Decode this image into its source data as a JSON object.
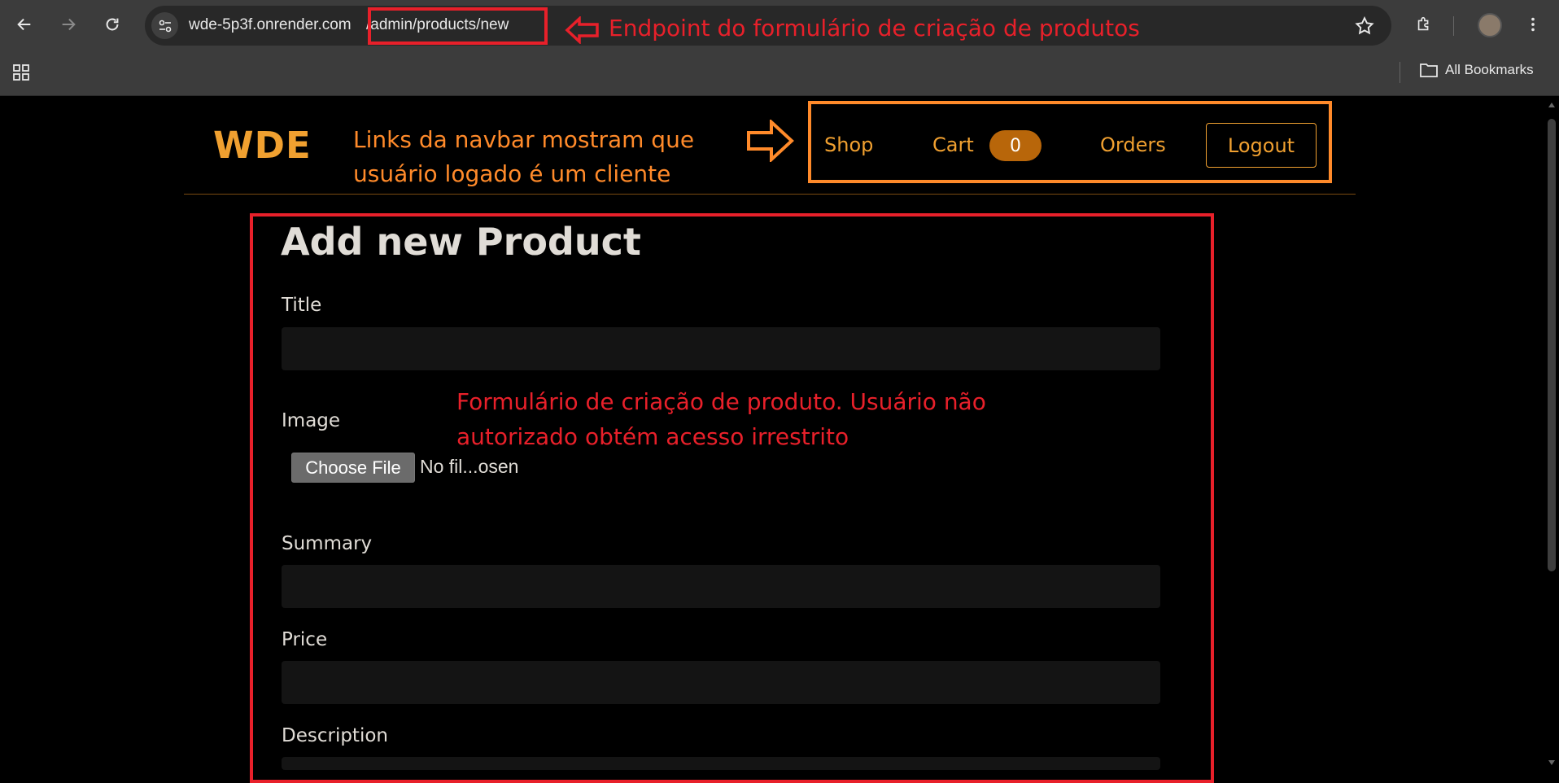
{
  "browser": {
    "url_host": "wde-5p3f.onrender.com",
    "url_path": "/admin/products/new",
    "bookmarks_label": "All Bookmarks"
  },
  "navbar": {
    "logo": "WDE",
    "shop": "Shop",
    "cart": "Cart",
    "cart_count": "0",
    "orders": "Orders",
    "logout": "Logout"
  },
  "form": {
    "title": "Add new Product",
    "title_label": "Title",
    "title_value": "",
    "image_label": "Image",
    "choose_file": "Choose File",
    "file_status": "No fil...osen",
    "summary_label": "Summary",
    "summary_value": "",
    "price_label": "Price",
    "price_value": "",
    "description_label": "Description"
  },
  "annotations": {
    "endpoint": "Endpoint do formulário de criação de produtos",
    "navbar_line1": "Links da navbar mostram que",
    "navbar_line2": "usuário logado é um cliente",
    "form_line1": "Formulário de criação de produto. Usuário não",
    "form_line2": "autorizado obtém acesso irrestrito"
  },
  "colors": {
    "accent": "#f0a030",
    "annotation_red": "#e8202a",
    "annotation_orange": "#ff8a2a",
    "cart_badge": "#b8660a"
  }
}
